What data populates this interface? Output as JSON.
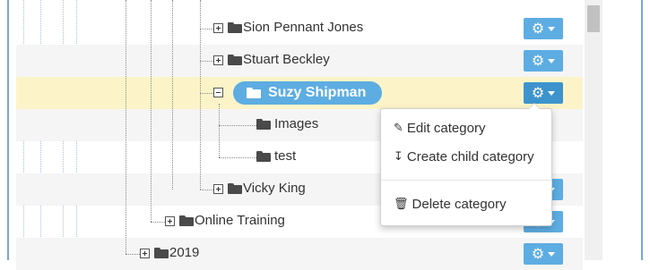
{
  "tree": {
    "nodes": [
      {
        "label": "Sion Pennant Jones",
        "icon": "folder-icon",
        "expander": "plus",
        "menu_icon": "gear-icon"
      },
      {
        "label": "Stuart Beckley",
        "icon": "folder-icon",
        "expander": "plus",
        "menu_icon": "gear-icon"
      },
      {
        "label": "Suzy Shipman",
        "icon": "folder-open-icon",
        "expander": "minus",
        "selected": true,
        "menu_icon": "gear-icon"
      },
      {
        "label": "Images",
        "icon": "folder-icon"
      },
      {
        "label": "test",
        "icon": "folder-icon"
      },
      {
        "label": "Vicky King",
        "icon": "folder-icon",
        "expander": "plus"
      },
      {
        "label": "Online Training",
        "icon": "folder-icon",
        "expander": "plus"
      },
      {
        "label": "2019",
        "icon": "folder-icon",
        "expander": "plus"
      }
    ]
  },
  "context_menu": {
    "items": [
      {
        "label": "Edit category",
        "icon": "edit-icon"
      },
      {
        "label": "Create child category",
        "icon": "arrow-down-icon"
      },
      {
        "label": "Delete category",
        "icon": "trash-icon"
      }
    ]
  },
  "colors": {
    "accent": "#5dade2",
    "selected_row": "#fcf4c8",
    "alt_row": "#f5f5f5",
    "frame_border": "#7aa5d6"
  }
}
